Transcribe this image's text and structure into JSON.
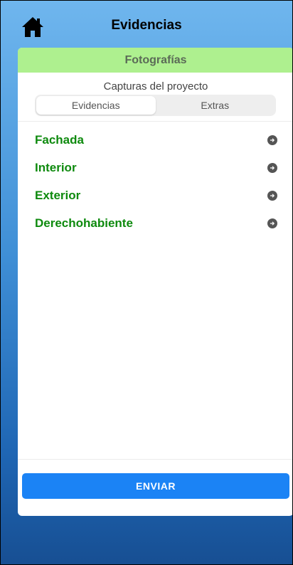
{
  "header": {
    "title": "Evidencias",
    "home_icon": "home-icon"
  },
  "card": {
    "header_title": "Fotografías",
    "subtitle": "Capturas del proyecto",
    "tabs": [
      {
        "label": "Evidencias",
        "active": true
      },
      {
        "label": "Extras",
        "active": false
      }
    ],
    "items": [
      {
        "label": "Fachada",
        "icon": "arrow-right-circle-icon"
      },
      {
        "label": "Interior",
        "icon": "arrow-right-circle-icon"
      },
      {
        "label": "Exterior",
        "icon": "arrow-right-circle-icon"
      },
      {
        "label": "Derechohabiente",
        "icon": "arrow-right-circle-icon"
      }
    ],
    "submit_label": "ENVIAR"
  },
  "colors": {
    "header_green": "#aef08f",
    "item_green": "#0e8a0e",
    "button_blue": "#1b83f5",
    "background_top": "#6fb6ee",
    "background_bottom": "#174f93"
  }
}
